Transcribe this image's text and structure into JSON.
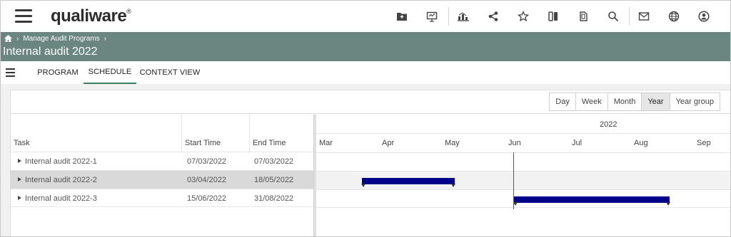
{
  "header": {
    "logo_text": "qualiware",
    "logo_mark": "®",
    "icons": [
      "folder-icon",
      "presentation-icon",
      "hierarchy-chart-icon",
      "share-icon",
      "star-icon",
      "columns-icon",
      "copy-icon",
      "search-icon",
      "mail-icon",
      "globe-icon",
      "user-icon"
    ]
  },
  "breadcrumb": {
    "home_icon": "home-icon",
    "items": [
      "Manage Audit Programs"
    ]
  },
  "page": {
    "title": "Internal audit 2022"
  },
  "tabs": [
    {
      "label": "PROGRAM",
      "active": false
    },
    {
      "label": "SCHEDULE",
      "active": true
    },
    {
      "label": "CONTEXT VIEW",
      "active": false
    }
  ],
  "view_buttons": [
    {
      "label": "Day",
      "active": false
    },
    {
      "label": "Week",
      "active": false
    },
    {
      "label": "Month",
      "active": false
    },
    {
      "label": "Year",
      "active": true
    },
    {
      "label": "Year group",
      "active": false
    }
  ],
  "grid": {
    "columns": [
      "Task",
      "Start Time",
      "End Time"
    ],
    "rows": [
      {
        "task": "Internal audit 2022-1",
        "start": "07/03/2022",
        "end": "07/03/2022",
        "selected": false
      },
      {
        "task": "Internal audit 2022-2",
        "start": "03/04/2022",
        "end": "18/05/2022",
        "selected": true
      },
      {
        "task": "Internal audit 2022-3",
        "start": "15/06/2022",
        "end": "31/08/2022",
        "selected": false
      }
    ]
  },
  "timeline": {
    "year": "2022",
    "months": [
      "Mar",
      "Apr",
      "May",
      "Jun",
      "Jul",
      "Aug",
      "Sep"
    ],
    "today": "01/06/2022",
    "bar_color": "#00008b",
    "today_color": "#e02020"
  },
  "colors": {
    "accent": "#6b8581",
    "tab_underline": "#3a7f5f"
  }
}
